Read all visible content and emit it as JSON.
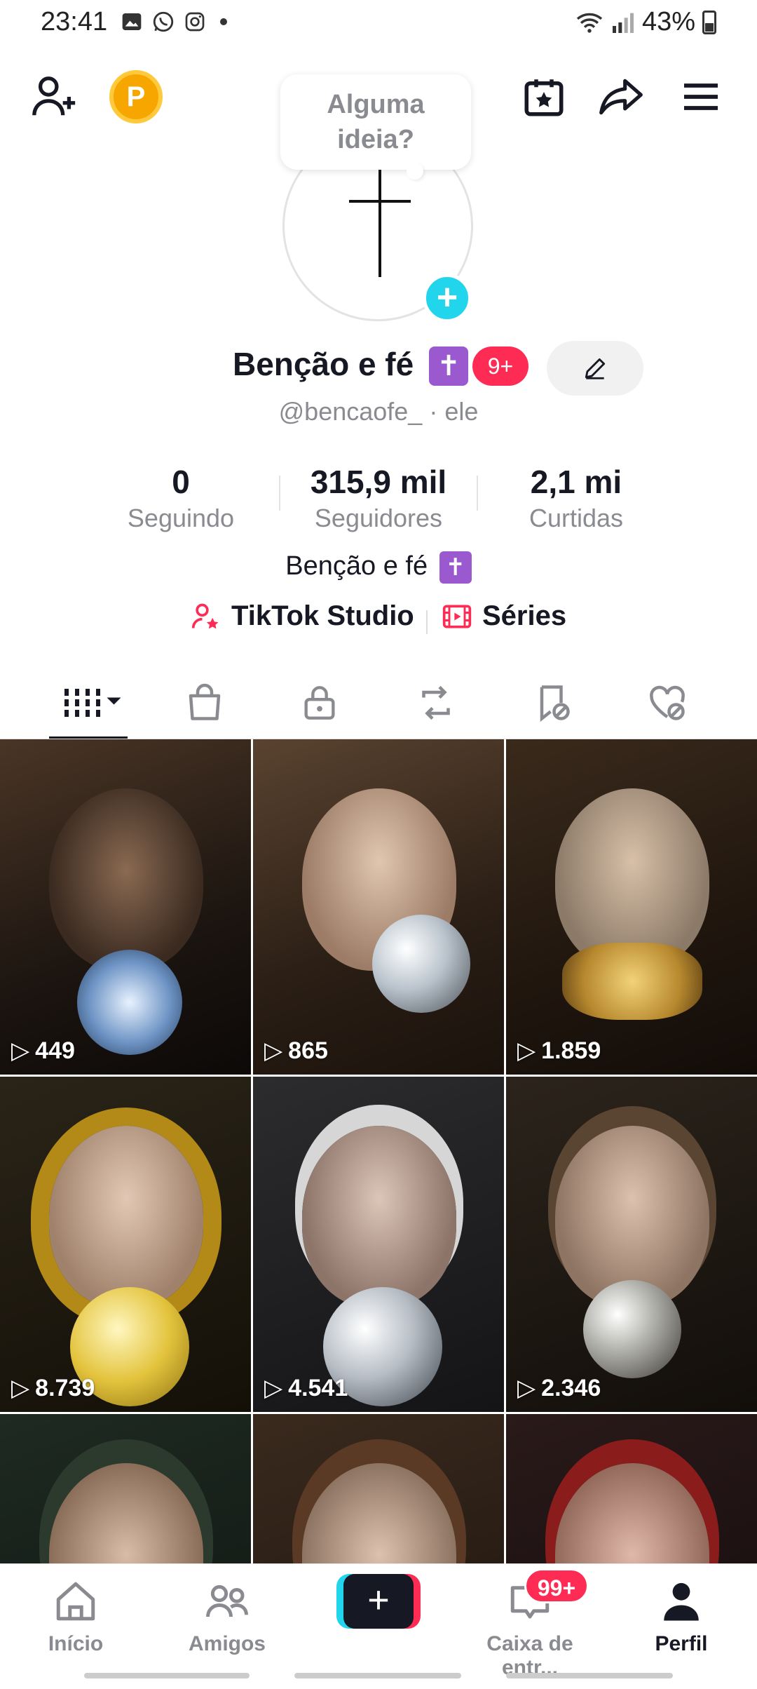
{
  "status_bar": {
    "time": "23:41",
    "battery": "43%"
  },
  "header": {
    "coin_letter": "P",
    "tooltip": "Alguma ideia?"
  },
  "profile": {
    "display_name": "Benção e fé",
    "name_emoji": "✝",
    "notification_badge": "9+",
    "handle": "@bencaofe_ · ele",
    "stats": [
      {
        "value": "0",
        "label": "Seguindo"
      },
      {
        "value": "315,9 mil",
        "label": "Seguidores"
      },
      {
        "value": "2,1 mi",
        "label": "Curtidas"
      }
    ],
    "bio": "Benção e fé",
    "bio_emoji": "✝",
    "links": [
      {
        "label": "TikTok Studio",
        "icon": "person-star-icon"
      },
      {
        "label": "Séries",
        "icon": "film-icon"
      }
    ]
  },
  "tabs": [
    {
      "name": "videos-grid-icon",
      "active": true
    },
    {
      "name": "shopping-bag-icon",
      "active": false
    },
    {
      "name": "lock-icon",
      "active": false
    },
    {
      "name": "repost-icon",
      "active": false
    },
    {
      "name": "bookmark-hidden-icon",
      "active": false
    },
    {
      "name": "heart-hidden-icon",
      "active": false
    }
  ],
  "videos": [
    {
      "views": "449"
    },
    {
      "views": "865"
    },
    {
      "views": "1.859"
    },
    {
      "views": "8.739"
    },
    {
      "views": "4.541"
    },
    {
      "views": "2.346"
    },
    {
      "views": ""
    },
    {
      "views": ""
    },
    {
      "views": ""
    }
  ],
  "bottom_nav": {
    "home": "Início",
    "friends": "Amigos",
    "inbox": "Caixa de entr...",
    "inbox_badge": "99+",
    "profile": "Perfil"
  },
  "colors": {
    "accent": "#fe2c55",
    "cyan": "#20d5ec",
    "text": "#161823",
    "muted": "#8a8b91"
  }
}
